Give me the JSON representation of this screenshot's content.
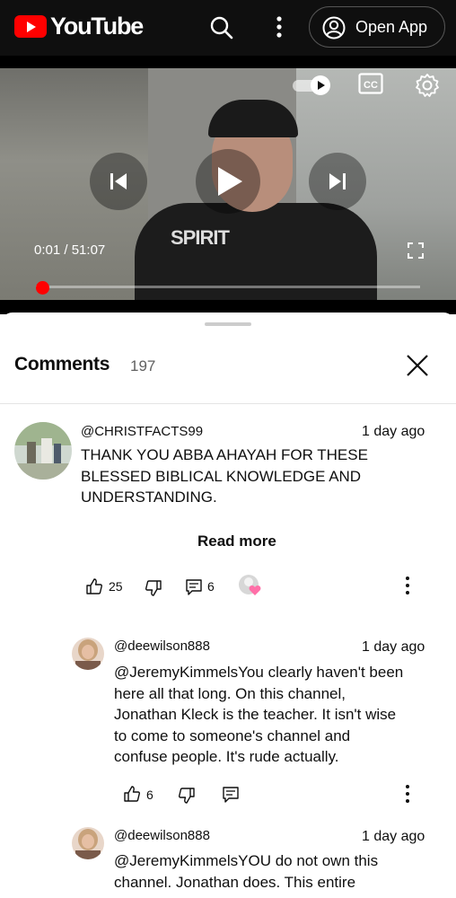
{
  "topbar": {
    "brand": "YouTube",
    "open_app_label": "Open App"
  },
  "player": {
    "time_current": "0:01",
    "time_total": "51:07",
    "time_separator": "/",
    "progress": 0.0003,
    "shirt_text": "SPIRIT"
  },
  "comments": {
    "title": "Comments",
    "count": "197",
    "read_more": "Read more",
    "items": [
      {
        "author": "@CHRISTFACTS99",
        "time": "1 day ago",
        "lines": [
          "THANK YOU ABBA AHAYAH FOR THESE",
          "BLESSED BIBLICAL KNOWLEDGE AND",
          "UNDERSTANDING."
        ],
        "likes": "25",
        "replies": "6"
      },
      {
        "author": "@deewilson888",
        "time": "1 day ago",
        "lines": [
          "@JeremyKimmelsYou clearly haven't been",
          "here all that long. On this channel,",
          "Jonathan Kleck is the teacher. It isn't wise",
          "to come to someone's channel and",
          "confuse people. It's rude actually."
        ],
        "likes": "6"
      },
      {
        "author": "@deewilson888",
        "time": "1 day ago",
        "lines": [
          "@JeremyKimmelsYOU do not own this",
          "channel. Jonathan does. This entire"
        ]
      }
    ]
  },
  "colors": {
    "brand_red": "#ff0000",
    "topbar_bg": "#0f0f0f",
    "heart": "#ff6fa8"
  }
}
